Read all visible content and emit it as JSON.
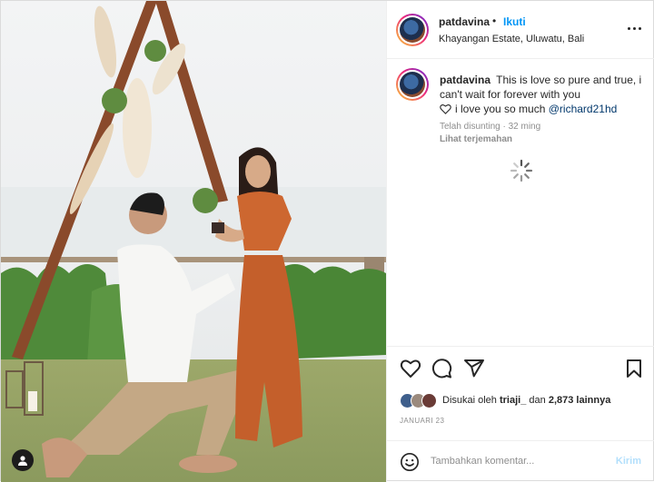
{
  "header": {
    "username": "patdavina",
    "separator": "•",
    "follow_label": "Ikuti",
    "location": "Khayangan Estate, Uluwatu, Bali",
    "more_icon": "more-horizontal-icon"
  },
  "caption": {
    "username": "patdavina",
    "text_before": "This is love so pure and true, i can't wait for forever with you",
    "heart_icon": "heart-outline-icon",
    "text_after": "i love you so much",
    "mention": "@richard21hd",
    "edited_time": "Telah disunting · 32 ming",
    "translate_label": "Lihat terjemahan"
  },
  "actions": {
    "icons": [
      "like-icon",
      "comment-icon",
      "share-icon",
      "save-icon"
    ]
  },
  "likes": {
    "prefix": "Disukai oleh",
    "user": "triaji_",
    "conjunction": "dan",
    "count": "2,873 lainnya"
  },
  "post_date": "JANUARI 23",
  "composer": {
    "placeholder": "Tambahkan komentar...",
    "post_label": "Kirim"
  },
  "colors": {
    "follow_blue": "#0095f6",
    "mention_blue": "#00376b",
    "post_disabled": "#b2dffc",
    "muted_text": "#8e8e8e"
  }
}
